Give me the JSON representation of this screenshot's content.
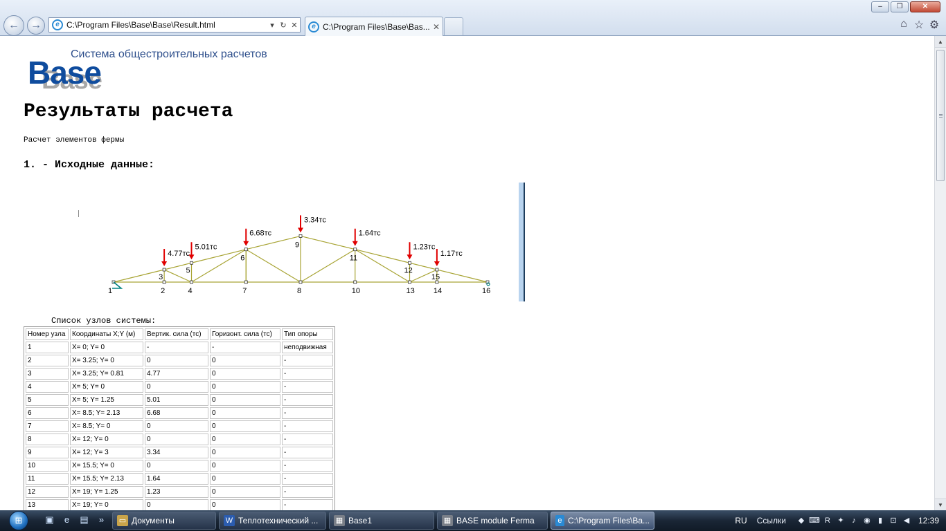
{
  "window": {
    "min": "–",
    "max": "❐",
    "close": "✕"
  },
  "browser": {
    "back_icon": "back-arrow-icon",
    "forward_icon": "forward-arrow-icon",
    "address": "C:\\Program Files\\Base\\Base\\Result.html",
    "address_controls": {
      "dropdown": "▾",
      "refresh": "↻",
      "stop": "✕"
    },
    "tab_title": "C:\\Program Files\\Base\\Bas...",
    "tab_close": "✕",
    "toolbar_icons": [
      "home-icon",
      "star-icon",
      "gear-icon"
    ]
  },
  "logo": {
    "caption": "Система общестроительных расчетов",
    "word": "Base"
  },
  "page": {
    "title": "Результаты расчета",
    "subtitle": "Расчет элементов фермы",
    "section1": "1. - Исходные данные:"
  },
  "truss": {
    "nodes": [
      {
        "id": "1",
        "x": 0,
        "y": 0
      },
      {
        "id": "2",
        "x": 3.25,
        "y": 0
      },
      {
        "id": "3",
        "x": 3.25,
        "y": 0.81
      },
      {
        "id": "4",
        "x": 5,
        "y": 0
      },
      {
        "id": "5",
        "x": 5,
        "y": 1.25
      },
      {
        "id": "6",
        "x": 8.5,
        "y": 2.13
      },
      {
        "id": "7",
        "x": 8.5,
        "y": 0
      },
      {
        "id": "8",
        "x": 12,
        "y": 0
      },
      {
        "id": "9",
        "x": 12,
        "y": 3
      },
      {
        "id": "10",
        "x": 15.5,
        "y": 0
      },
      {
        "id": "11",
        "x": 15.5,
        "y": 2.13
      },
      {
        "id": "12",
        "x": 19,
        "y": 1.25
      },
      {
        "id": "13",
        "x": 19,
        "y": 0
      },
      {
        "id": "14",
        "x": 20.75,
        "y": 0
      },
      {
        "id": "15",
        "x": 20.75,
        "y": 0.81
      },
      {
        "id": "16",
        "x": 24,
        "y": 0
      }
    ],
    "loads": [
      {
        "node": "3",
        "label": "4.77тс"
      },
      {
        "node": "5",
        "label": "5.01тс"
      },
      {
        "node": "6",
        "label": "6.68тс"
      },
      {
        "node": "9",
        "label": "3.34тс"
      },
      {
        "node": "11",
        "label": "1.64тс"
      },
      {
        "node": "12",
        "label": "1.23тс"
      },
      {
        "node": "15",
        "label": "1.17тс"
      }
    ],
    "colors": {
      "member": "#a8a434",
      "load": "#e00000",
      "support": "#008080"
    }
  },
  "nodes_table": {
    "caption": "Список узлов системы:",
    "headers": [
      "Номер узла",
      "Координаты X;Y (м)",
      "Вертик. сила (тс)",
      "Горизонт. сила (тс)",
      "Тип опоры"
    ],
    "rows": [
      [
        "1",
        "X= 0; Y= 0",
        "-",
        "-",
        "неподвижная"
      ],
      [
        "2",
        "X= 3.25; Y= 0",
        "0",
        "0",
        "-"
      ],
      [
        "3",
        "X= 3.25; Y= 0.81",
        "4.77",
        "0",
        "-"
      ],
      [
        "4",
        "X= 5; Y= 0",
        "0",
        "0",
        "-"
      ],
      [
        "5",
        "X= 5; Y= 1.25",
        "5.01",
        "0",
        "-"
      ],
      [
        "6",
        "X= 8.5; Y= 2.13",
        "6.68",
        "0",
        "-"
      ],
      [
        "7",
        "X= 8.5; Y= 0",
        "0",
        "0",
        "-"
      ],
      [
        "8",
        "X= 12; Y= 0",
        "0",
        "0",
        "-"
      ],
      [
        "9",
        "X= 12; Y= 3",
        "3.34",
        "0",
        "-"
      ],
      [
        "10",
        "X= 15.5; Y= 0",
        "0",
        "0",
        "-"
      ],
      [
        "11",
        "X= 15.5; Y= 2.13",
        "1.64",
        "0",
        "-"
      ],
      [
        "12",
        "X= 19; Y= 1.25",
        "1.23",
        "0",
        "-"
      ],
      [
        "13",
        "X= 19; Y= 0",
        "0",
        "0",
        "-"
      ]
    ]
  },
  "taskbar": {
    "start_icon": "windows-orb-icon",
    "quick_launch": [
      "show-desktop-icon",
      "ie-icon",
      "switch-windows-icon"
    ],
    "quick_more": "»",
    "items": [
      {
        "label": "Документы",
        "icon": "folder-icon",
        "active": false
      },
      {
        "label": "Теплотехнический ...",
        "icon": "word-icon",
        "active": false
      },
      {
        "label": "Base1",
        "icon": "app-icon",
        "active": false
      },
      {
        "label": "BASE module Ferma",
        "icon": "app-icon",
        "active": false
      },
      {
        "label": "C:\\Program Files\\Ba...",
        "icon": "ie-icon",
        "active": true
      }
    ],
    "lang": "RU",
    "links": "Ссылки",
    "clock": "12:39"
  }
}
